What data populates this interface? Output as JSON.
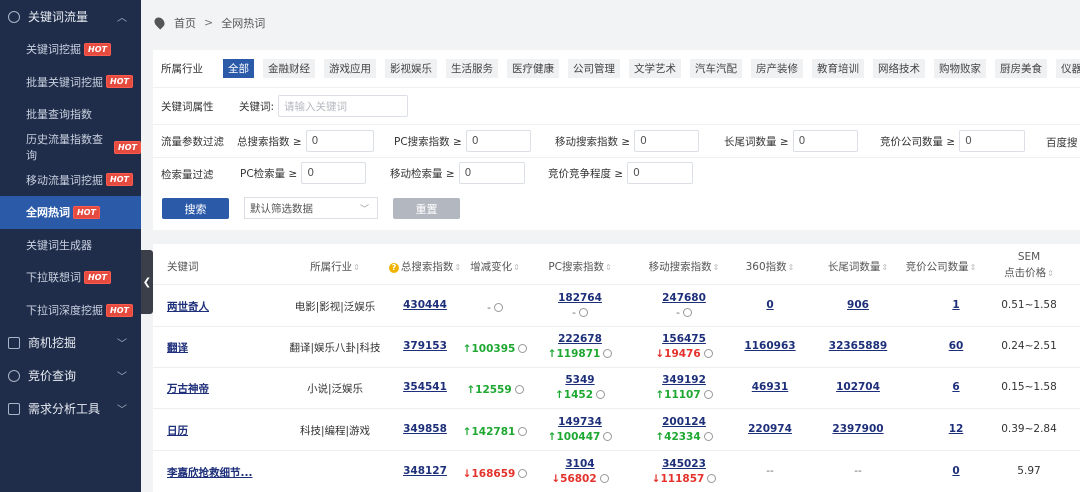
{
  "sidebar": {
    "section1": "关键词流量",
    "items": [
      {
        "label": "关键词挖掘",
        "hot": "HOT"
      },
      {
        "label": "批量关键词挖掘",
        "hot": "HOT"
      },
      {
        "label": "批量查询指数",
        "hot": ""
      },
      {
        "label": "历史流量指数查询",
        "hot": "HOT"
      },
      {
        "label": "移动流量词挖掘",
        "hot": "HOT"
      },
      {
        "label": "全网热词",
        "hot": "HOT"
      },
      {
        "label": "关键词生成器",
        "hot": ""
      },
      {
        "label": "下拉联想词",
        "hot": "HOT"
      },
      {
        "label": "下拉词深度挖掘",
        "hot": "HOT"
      }
    ],
    "section2": "商机挖掘",
    "section3": "竞价查询",
    "section4": "需求分析工具"
  },
  "breadcrumb": {
    "home": "首页",
    "sep": ">",
    "current": "全网热词"
  },
  "filters": {
    "industry_label": "所属行业",
    "industries": [
      "全部",
      "金融财经",
      "游戏应用",
      "影视娱乐",
      "生活服务",
      "医疗健康",
      "公司管理",
      "文学艺术",
      "汽车汽配",
      "房产装修",
      "教育培训",
      "网络技术",
      "购物败家",
      "厨房美食",
      "仪器机械"
    ],
    "kw_attr_label": "关键词属性",
    "kw_label": "关键词:",
    "kw_placeholder": "请输入关键词",
    "flow_label": "流量参数过滤",
    "total_idx": "总搜索指数 ≥",
    "pc_idx": "PC搜索指数 ≥",
    "mobile_idx": "移动搜索指数 ≥",
    "longtail": "长尾词数量 ≥",
    "bid_companies": "竞价公司数量 ≥",
    "baidu": "百度搜",
    "search_vol_label": "检索量过滤",
    "pc_vol": "PC检索量 ≥",
    "mobile_vol": "移动检索量 ≥",
    "bid_degree": "竞价竞争程度 ≥",
    "zero": "0",
    "search_btn": "搜索",
    "select_default": "默认筛选数据",
    "reset_btn": "重置"
  },
  "table": {
    "headers": [
      "关键词",
      "所属行业",
      "总搜索指数",
      "增减变化",
      "PC搜索指数",
      "移动搜索指数",
      "360指数",
      "长尾词数量",
      "竞价公司数量",
      "SEM",
      "点击价格"
    ],
    "rows": [
      {
        "kw": "两世奇人",
        "industry": "电影|影视|泛娱乐",
        "total": "430444",
        "change": "-",
        "change_dir": "none",
        "pc": "182764",
        "pc_change": "-",
        "pc_dir": "none",
        "mobile": "247680",
        "mobile_change": "-",
        "mobile_dir": "none",
        "i360": "0",
        "longtail": "906",
        "bid": "1",
        "sem": "0.51~1.58"
      },
      {
        "kw": "翻译",
        "industry": "翻译|娱乐八卦|科技",
        "total": "379153",
        "change": "100395",
        "change_dir": "up",
        "pc": "222678",
        "pc_change": "119871",
        "pc_dir": "up",
        "mobile": "156475",
        "mobile_change": "19476",
        "mobile_dir": "down",
        "i360": "1160963",
        "longtail": "32365889",
        "bid": "60",
        "sem": "0.24~2.51"
      },
      {
        "kw": "万古神帝",
        "industry": "小说|泛娱乐",
        "total": "354541",
        "change": "12559",
        "change_dir": "up",
        "pc": "5349",
        "pc_change": "1452",
        "pc_dir": "up",
        "mobile": "349192",
        "mobile_change": "11107",
        "mobile_dir": "up",
        "i360": "46931",
        "longtail": "102704",
        "bid": "6",
        "sem": "0.15~1.58"
      },
      {
        "kw": "日历",
        "industry": "科技|编程|游戏",
        "total": "349858",
        "change": "142781",
        "change_dir": "up",
        "pc": "149734",
        "pc_change": "100447",
        "pc_dir": "up",
        "mobile": "200124",
        "mobile_change": "42334",
        "mobile_dir": "up",
        "i360": "220974",
        "longtail": "2397900",
        "bid": "12",
        "sem": "0.39~2.84"
      },
      {
        "kw": "李嘉欣抢救细节...",
        "industry": "",
        "total": "348127",
        "change": "168659",
        "change_dir": "down",
        "pc": "3104",
        "pc_change": "56802",
        "pc_dir": "down",
        "mobile": "345023",
        "mobile_change": "111857",
        "mobile_dir": "down",
        "i360": "--",
        "longtail": "--",
        "bid": "0",
        "sem": "5.97"
      }
    ]
  },
  "colors": {
    "sidebar_bg": "#1f2d4a",
    "accent": "#2a5aa8",
    "up": "#1ea832",
    "down": "#e4322c",
    "hot": "#e64b3f"
  }
}
